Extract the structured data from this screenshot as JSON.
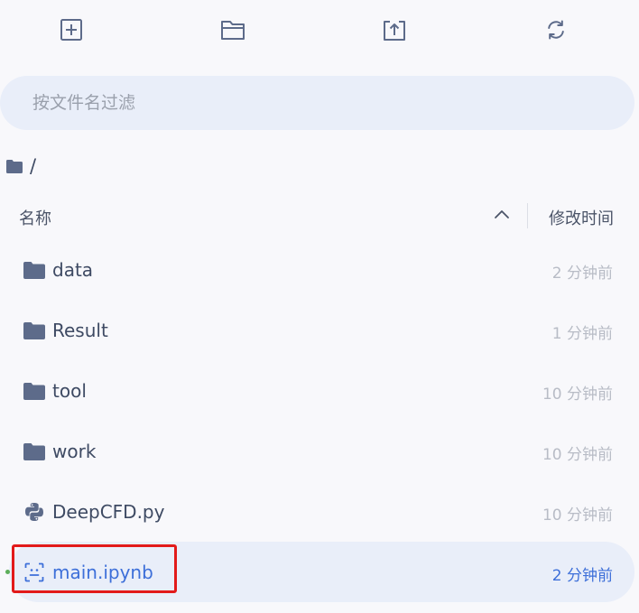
{
  "toolbar": {
    "new_file_icon": "plus-square-icon",
    "new_folder_icon": "folder-icon",
    "upload_icon": "upload-icon",
    "refresh_icon": "refresh-icon"
  },
  "search": {
    "placeholder": "按文件名过滤",
    "value": ""
  },
  "breadcrumb": {
    "root_icon": "folder-icon",
    "path": "/"
  },
  "table": {
    "columns": {
      "name": "名称",
      "modified": "修改时间"
    },
    "sort_icon": "chevron-up-icon"
  },
  "files": [
    {
      "name": "data",
      "type": "folder",
      "icon": "folder-icon",
      "modified": "2 分钟前"
    },
    {
      "name": "Result",
      "type": "folder",
      "icon": "folder-icon",
      "modified": "1 分钟前"
    },
    {
      "name": "tool",
      "type": "folder",
      "icon": "folder-icon",
      "modified": "10 分钟前"
    },
    {
      "name": "work",
      "type": "folder",
      "icon": "folder-icon",
      "modified": "10 分钟前"
    },
    {
      "name": "DeepCFD.py",
      "type": "python",
      "icon": "python-icon",
      "modified": "10 分钟前"
    },
    {
      "name": "main.ipynb",
      "type": "notebook",
      "icon": "notebook-icon",
      "modified": "2 分钟前",
      "selected": true,
      "running": true
    }
  ],
  "colors": {
    "accent": "#3d6fd9",
    "selection_bg": "#e9eef9",
    "highlight_border": "#e21a1a",
    "running_dot": "#5cae5a",
    "icon": "#5d6b8a"
  }
}
